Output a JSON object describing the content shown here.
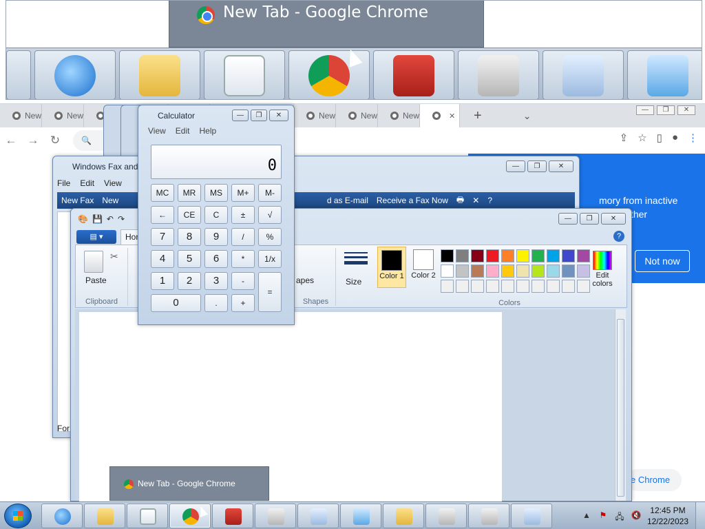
{
  "zoom_strip": {
    "tooltip_title": "New Tab - Google Chrome",
    "icons": [
      "ie-icon",
      "explorer-icon",
      "media-center-icon",
      "chrome-icon",
      "toolbox-icon",
      "safe-icon",
      "magnifier-icon",
      "plane-icon"
    ]
  },
  "chrome": {
    "tab_label": "New",
    "tab_count": 11,
    "popup_text": "mory from inactive\ns and other",
    "not_now": "Not now",
    "pill_text": "e Chrome"
  },
  "fax": {
    "title": "Windows Fax and",
    "menu": [
      "File",
      "Edit",
      "View"
    ],
    "toolbar": {
      "new_fax": "New Fax",
      "new": "New",
      "forward_email": "d as E-mail",
      "receive": "Receive a Fax Now"
    },
    "bottom": "For"
  },
  "paint": {
    "file_tab": "",
    "home_tab": "Hon",
    "clipboard": {
      "paste": "Paste",
      "group": "Clipboard"
    },
    "shapes_label": "apes",
    "shapes_group": "Shapes",
    "size": "Size",
    "color1": "Color 1",
    "color2": "Color 2",
    "colors_group": "Colors",
    "edit_colors": "Edit colors",
    "palette": [
      "#000000",
      "#7f7f7f",
      "#880015",
      "#ed1c24",
      "#ff7f27",
      "#fff200",
      "#22b14c",
      "#00a2e8",
      "#3f48cc",
      "#a349a4",
      "#ffffff",
      "#c3c3c3",
      "#b97a57",
      "#ffaec9",
      "#ffc90e",
      "#efe4b0",
      "#b5e61d",
      "#99d9ea",
      "#7092be",
      "#c8bfe7",
      "#f0f0f0",
      "#f0f0f0",
      "#f0f0f0",
      "#f0f0f0",
      "#f0f0f0",
      "#f0f0f0",
      "#f0f0f0",
      "#f0f0f0",
      "#f0f0f0",
      "#f0f0f0"
    ],
    "color1_value": "#000000",
    "color2_value": "#ffffff"
  },
  "calculator": {
    "title": "Calculator",
    "menu": [
      "View",
      "Edit",
      "Help"
    ],
    "display": "0",
    "keys": [
      [
        "MC",
        "MR",
        "MS",
        "M+",
        "M-"
      ],
      [
        "←",
        "CE",
        "C",
        "±",
        "√"
      ],
      [
        "7",
        "8",
        "9",
        "/",
        "%"
      ],
      [
        "4",
        "5",
        "6",
        "*",
        "1/x"
      ],
      [
        "1",
        "2",
        "3",
        "-",
        "="
      ],
      [
        "0",
        ".",
        "+"
      ]
    ]
  },
  "thumb_tooltip": "New Tab - Google Chrome",
  "taskbar": {
    "pinned": [
      "ie-icon",
      "explorer-icon",
      "media-center-icon",
      "chrome-icon",
      "toolbox-icon",
      "safe-icon",
      "magnifier-icon",
      "plane-icon",
      "sticky-notes-icon",
      "calculator-icon",
      "fax-icon",
      "paint-icon"
    ],
    "time": "12:45 PM",
    "date": "12/22/2023"
  }
}
